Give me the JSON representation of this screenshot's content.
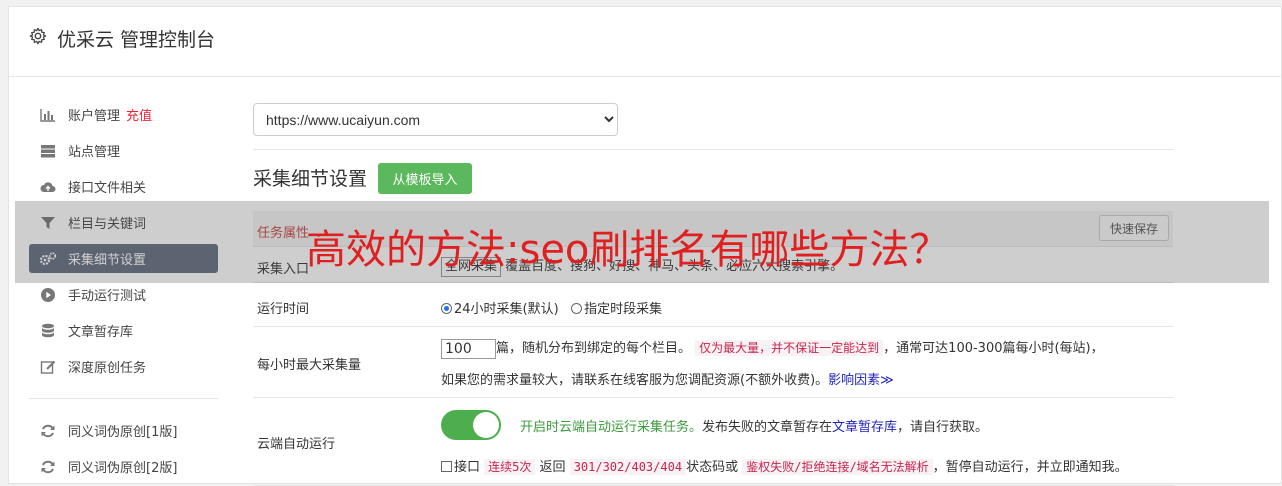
{
  "header": {
    "title": "优采云 管理控制台"
  },
  "sidebar": {
    "items": [
      {
        "label": "账户管理",
        "icon": "bar-chart-icon",
        "extra": "充值"
      },
      {
        "label": "站点管理",
        "icon": "server-icon"
      },
      {
        "label": "接口文件相关",
        "icon": "cloud-upload-icon"
      },
      {
        "label": "栏目与关键词",
        "icon": "filter-icon"
      },
      {
        "label": "采集细节设置",
        "icon": "gears-icon",
        "active": true
      },
      {
        "label": "手动运行测试",
        "icon": "play-circle-icon"
      },
      {
        "label": "文章暂存库",
        "icon": "database-icon"
      },
      {
        "label": "深度原创任务",
        "icon": "edit-icon"
      },
      {
        "label": "同义词伪原创[1版]",
        "icon": "refresh-icon"
      },
      {
        "label": "同义词伪原创[2版]",
        "icon": "refresh-icon"
      }
    ]
  },
  "main": {
    "site_select": "https://www.ucaiyun.com",
    "section_title": "采集细节设置",
    "import_button": "从模板导入",
    "task_header": "任务属性",
    "task_header_arrow": "⌄",
    "quick_save": "快速保存",
    "rows": {
      "entry": {
        "label": "采集入口",
        "box": "全网采集",
        "desc": "覆盖百度、搜狗、好搜、神马、头条、必应六大搜索引擎。"
      },
      "runtime": {
        "label": "运行时间",
        "opt1": "24小时采集(默认)",
        "opt2": "指定时段采集"
      },
      "max": {
        "label": "每小时最大采集量",
        "value": "100",
        "text1": "篇，随机分布到绑定的每个栏目。",
        "code1": "仅为最大量，并不保证一定能达到",
        "text2": "，通常可达100-300篇每小时(每站)，",
        "text3": "如果您的需求量较大，请联系在线客服为您调配资源(不额外收费)。",
        "link": "影响因素",
        "link_arrow": "≫"
      },
      "cloud": {
        "label": "云端自动运行",
        "green": "开启时云端自动运行采集任务。",
        "text1": "发布失败的文章暂存在",
        "link": "文章暂存库",
        "text2": "，请自行获取。",
        "chk_label": "接口",
        "code1": "连续5次",
        "text3": "返回",
        "code2": "301/302/403/404",
        "text4": "状态码或",
        "code3": "鉴权失败/拒绝连接/域名无法解析",
        "text5": "，暂停自动运行，并立即通知我。"
      }
    }
  },
  "overlay_text": "高效的方法:seo刷排名有哪些方法？"
}
